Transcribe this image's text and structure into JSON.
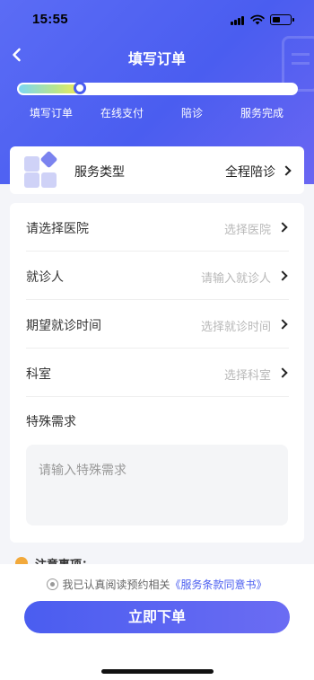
{
  "status_bar": {
    "time": "15:55"
  },
  "nav": {
    "title": "填写订单",
    "back_icon": "chevron-left-icon"
  },
  "progress": {
    "value_fraction": 0.22,
    "steps": [
      "填写订单",
      "在线支付",
      "陪诊",
      "服务完成"
    ],
    "current_step": 0
  },
  "service": {
    "label": "服务类型",
    "value": "全程陪诊",
    "icon": "service-grid-icon"
  },
  "form": {
    "rows": [
      {
        "label": "请选择医院",
        "placeholder": "选择医院"
      },
      {
        "label": "就诊人",
        "placeholder": "请输入就诊人"
      },
      {
        "label": "期望就诊时间",
        "placeholder": "选择就诊时间"
      },
      {
        "label": "科室",
        "placeholder": "选择科室"
      }
    ],
    "special_label": "特殊需求",
    "special_placeholder": "请输入特殊需求"
  },
  "notice": {
    "title": "注意事项："
  },
  "bottom": {
    "agree_text": "我已认真阅读预约相关",
    "agree_link": "《服务条款同意书》",
    "submit_label": "立即下单"
  },
  "colors": {
    "brand": "#4a5df0",
    "accent_link": "#4a5df0",
    "notice_icon": "#f2a93b"
  }
}
